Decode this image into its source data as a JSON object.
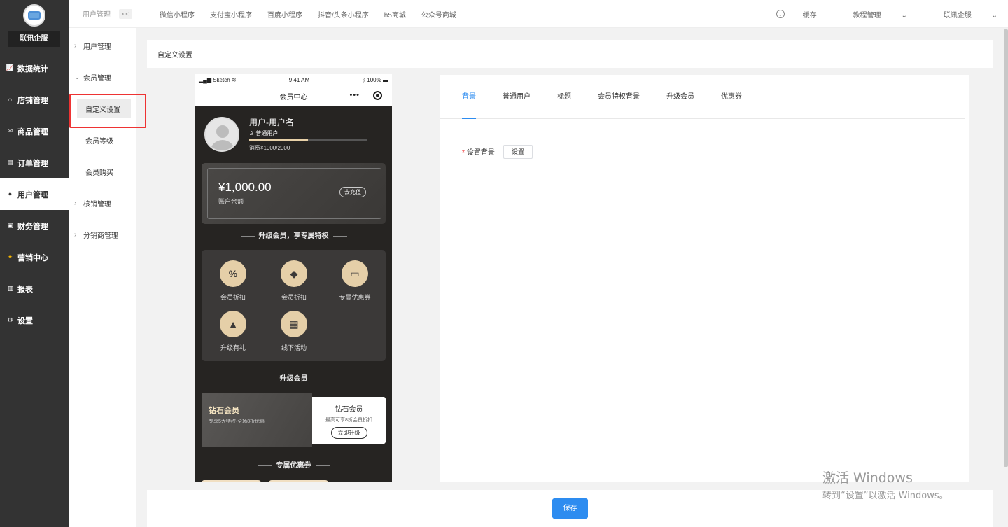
{
  "sidebar": {
    "brand": "联讯企服",
    "items": [
      {
        "label": "数据统计",
        "icon": "chart-icon"
      },
      {
        "label": "店铺管理",
        "icon": "store-icon"
      },
      {
        "label": "商品管理",
        "icon": "goods-icon"
      },
      {
        "label": "订单管理",
        "icon": "order-icon"
      },
      {
        "label": "用户管理",
        "icon": "user-icon"
      },
      {
        "label": "财务管理",
        "icon": "finance-icon"
      },
      {
        "label": "营销中心",
        "icon": "marketing-icon"
      },
      {
        "label": "报表",
        "icon": "report-icon"
      },
      {
        "label": "设置",
        "icon": "gear-icon"
      }
    ],
    "active_index": 4
  },
  "submenu": {
    "header": "用户管理",
    "collapse_label": "<<",
    "groups": [
      {
        "label": "用户管理"
      },
      {
        "label": "会员管理",
        "children": [
          "自定义设置",
          "会员等级",
          "会员购买"
        ]
      },
      {
        "label": "核销管理"
      },
      {
        "label": "分销商管理"
      }
    ]
  },
  "topbar": {
    "tabs": [
      "微信小程序",
      "支付宝小程序",
      "百度小程序",
      "抖音/头条小程序",
      "h5商城",
      "公众号商城"
    ],
    "cache": "缓存",
    "tutorial": "教程管理",
    "account": "联讯企服"
  },
  "breadcrumb": "自定义设置",
  "phone": {
    "status_left": "Sketch",
    "time": "9:41 AM",
    "battery": "100%",
    "title": "会员中心",
    "user_name": "用户-用户名",
    "user_level": "普通用户",
    "progress": 0.5,
    "consumption": "消费¥1000/2000",
    "balance": "¥1,000.00",
    "balance_label": "账户余额",
    "recharge": "去充值",
    "section_privilege": "升级会员，享专属特权",
    "privileges": [
      {
        "label": "会员折扣",
        "icon": "percent-icon"
      },
      {
        "label": "会员折扣",
        "icon": "tag-icon"
      },
      {
        "label": "专属优惠券",
        "icon": "coupon-icon"
      },
      {
        "label": "升级有礼",
        "icon": "arrow-up-icon"
      },
      {
        "label": "线下活动",
        "icon": "gift-icon"
      }
    ],
    "section_upgrade": "升级会员",
    "diamond_title": "钻石会员",
    "diamond_desc": "专享5大特权·全场8折优惠",
    "upgrade_title": "钻石会员",
    "upgrade_desc": "最高可享8折会员折扣",
    "upgrade_btn": "立即升级",
    "section_coupons": "专属优惠券"
  },
  "panel": {
    "tabs": [
      "背景",
      "普通用户",
      "标题",
      "会员特权背景",
      "升级会员",
      "优惠券"
    ],
    "active_tab": 0,
    "field_required": "*",
    "field_label": "设置背景",
    "field_button": "设置"
  },
  "footer": {
    "save": "保存"
  },
  "watermark": {
    "line1": "激活 Windows",
    "line2": "转到“设置”以激活 Windows。"
  },
  "colors": {
    "primary": "#2d8cf0",
    "sidebar": "#333333",
    "phone_bg": "#262422",
    "gold": "#e5cfa8",
    "highlight": "#ee3333"
  }
}
